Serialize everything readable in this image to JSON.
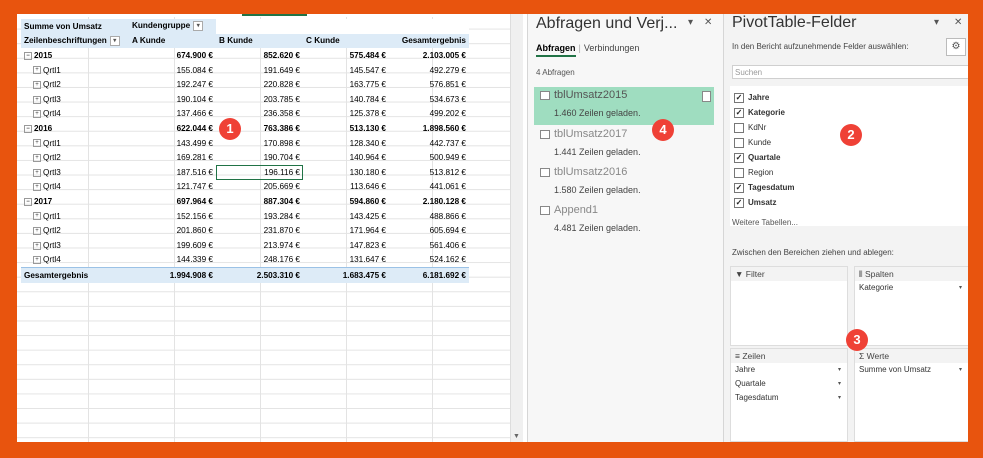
{
  "pivot": {
    "header1": {
      "measure": "Summe von Umsatz",
      "colgroup": "Kundengruppe"
    },
    "header2": {
      "rowlabel": "Zeilenbeschriftungen",
      "cols": [
        "A Kunde",
        "B Kunde",
        "C Kunde",
        "Gesamtergebnis"
      ]
    },
    "years": [
      {
        "label": "2015",
        "values": [
          "674.900 €",
          "852.620 €",
          "575.484 €",
          "2.103.005 €"
        ],
        "quarters": [
          {
            "label": "Qrtl1",
            "values": [
              "155.084 €",
              "191.649 €",
              "145.547 €",
              "492.279 €"
            ]
          },
          {
            "label": "Qrtl2",
            "values": [
              "192.247 €",
              "220.828 €",
              "163.775 €",
              "576.851 €"
            ]
          },
          {
            "label": "Qrtl3",
            "values": [
              "190.104 €",
              "203.785 €",
              "140.784 €",
              "534.673 €"
            ]
          },
          {
            "label": "Qrtl4",
            "values": [
              "137.466 €",
              "236.358 €",
              "125.378 €",
              "499.202 €"
            ]
          }
        ]
      },
      {
        "label": "2016",
        "values": [
          "622.044 €",
          "763.386 €",
          "513.130 €",
          "1.898.560 €"
        ],
        "quarters": [
          {
            "label": "Qrtl1",
            "values": [
              "143.499 €",
              "170.898 €",
              "128.340 €",
              "442.737 €"
            ]
          },
          {
            "label": "Qrtl2",
            "values": [
              "169.281 €",
              "190.704 €",
              "140.964 €",
              "500.949 €"
            ]
          },
          {
            "label": "Qrtl3",
            "values": [
              "187.516 €",
              "196.116 €",
              "130.180 €",
              "513.812 €"
            ]
          },
          {
            "label": "Qrtl4",
            "values": [
              "121.747 €",
              "205.669 €",
              "113.646 €",
              "441.061 €"
            ]
          }
        ]
      },
      {
        "label": "2017",
        "values": [
          "697.964 €",
          "887.304 €",
          "594.860 €",
          "2.180.128 €"
        ],
        "quarters": [
          {
            "label": "Qrtl1",
            "values": [
              "152.156 €",
              "193.284 €",
              "143.425 €",
              "488.866 €"
            ]
          },
          {
            "label": "Qrtl2",
            "values": [
              "201.860 €",
              "231.870 €",
              "171.964 €",
              "605.694 €"
            ]
          },
          {
            "label": "Qrtl3",
            "values": [
              "199.609 €",
              "213.974 €",
              "147.823 €",
              "561.406 €"
            ]
          },
          {
            "label": "Qrtl4",
            "values": [
              "144.339 €",
              "248.176 €",
              "131.647 €",
              "524.162 €"
            ]
          }
        ]
      }
    ],
    "total": {
      "label": "Gesamtergebnis",
      "values": [
        "1.994.908 €",
        "2.503.310 €",
        "1.683.475 €",
        "6.181.692 €"
      ]
    }
  },
  "badges": {
    "b1": "1",
    "b2": "2",
    "b3": "3",
    "b4": "4"
  },
  "queries": {
    "title": "Abfragen und Verj...",
    "tab_active": "Abfragen",
    "tab_other": "Verbindungen",
    "count": "4 Abfragen",
    "items": [
      {
        "name": "tblUmsatz2015",
        "status": "1.460 Zeilen geladen."
      },
      {
        "name": "tblUmsatz2017",
        "status": "1.441 Zeilen geladen."
      },
      {
        "name": "tblUmsatz2016",
        "status": "1.580 Zeilen geladen."
      },
      {
        "name": "Append1",
        "status": "4.481 Zeilen geladen."
      }
    ]
  },
  "fields": {
    "title": "PivotTable-Felder",
    "subtitle": "In den Bericht aufzunehmende Felder auswählen:",
    "search_placeholder": "Suchen",
    "list": [
      {
        "name": "Jahre",
        "checked": true
      },
      {
        "name": "Kategorie",
        "checked": true
      },
      {
        "name": "KdNr",
        "checked": false
      },
      {
        "name": "Kunde",
        "checked": false
      },
      {
        "name": "Quartale",
        "checked": true
      },
      {
        "name": "Region",
        "checked": false
      },
      {
        "name": "Tagesdatum",
        "checked": true
      },
      {
        "name": "Umsatz",
        "checked": true
      }
    ],
    "more_tables": "Weitere Tabellen...",
    "drag_label": "Zwischen den Bereichen ziehen und ablegen:",
    "filter_label": "Filter",
    "columns_label": "Spalten",
    "columns_items": [
      "Kategorie"
    ],
    "rows_label": "Zeilen",
    "rows_items": [
      "Jahre",
      "Quartale",
      "Tagesdatum"
    ],
    "values_label": "Werte",
    "values_items": [
      "Summe von Umsatz"
    ]
  },
  "colors": {
    "accent": "#217346",
    "frame": "#E8540E",
    "badge": "#EF4136",
    "pivot_header": "#DDEBF7",
    "query_active": "#9FDDC0"
  }
}
